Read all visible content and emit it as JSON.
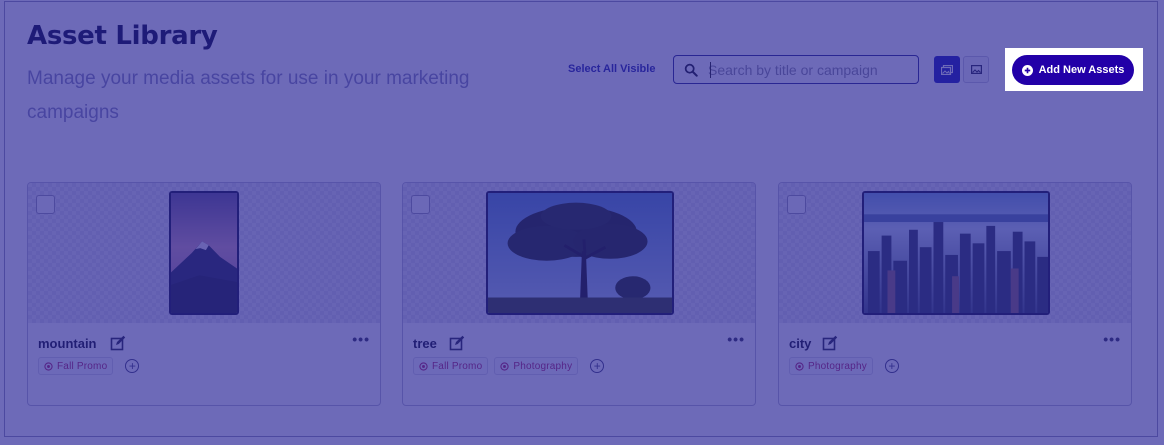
{
  "header": {
    "title": "Asset Library",
    "subtitle": "Manage your media assets for use in your marketing campaigns",
    "select_all_label": "Select All Visible"
  },
  "search": {
    "placeholder": "Search by title or campaign",
    "value": "",
    "icon": "search-icon"
  },
  "view_toggle": {
    "grid_icon": "gallery-view-icon",
    "single_icon": "image-view-icon",
    "active": "grid"
  },
  "add_button": {
    "label": "Add New Assets",
    "icon": "plus-circle-icon"
  },
  "assets": [
    {
      "name": "mountain",
      "tags": [
        "Fall Promo"
      ],
      "image": "mountain-photo"
    },
    {
      "name": "tree",
      "tags": [
        "Fall Promo",
        "Photography"
      ],
      "image": "tree-photo"
    },
    {
      "name": "city",
      "tags": [
        "Photography"
      ],
      "image": "city-photo"
    }
  ],
  "colors": {
    "overlay": "#2824a0",
    "accent": "#2200a8",
    "tag_text": "#b42a6a",
    "title": "#0a0a3a"
  }
}
